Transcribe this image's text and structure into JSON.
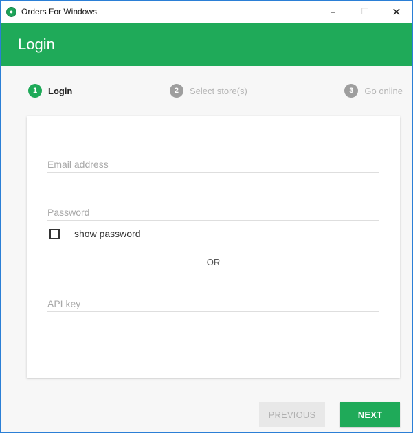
{
  "window": {
    "title": "Orders For Windows",
    "controls": {
      "minimize": "–",
      "maximize": "☐",
      "close": "✕"
    }
  },
  "header": {
    "title": "Login"
  },
  "stepper": {
    "steps": [
      {
        "number": "1",
        "label": "Login",
        "state": "active"
      },
      {
        "number": "2",
        "label": "Select store(s)",
        "state": "inactive"
      },
      {
        "number": "3",
        "label": "Go online",
        "state": "inactive"
      }
    ]
  },
  "form": {
    "email": {
      "placeholder": "Email address",
      "value": ""
    },
    "password": {
      "placeholder": "Password",
      "value": ""
    },
    "show_password": {
      "label": "show password",
      "checked": false
    },
    "or_label": "OR",
    "api_key": {
      "placeholder": "API key",
      "value": ""
    }
  },
  "actions": {
    "previous_label": "PREVIOUS",
    "next_label": "NEXT"
  },
  "colors": {
    "accent": "#1faa59",
    "inactive_step": "#9e9e9e",
    "disabled_button": "#e8e8e8"
  },
  "icons": {
    "app": "app-logo-icon",
    "minimize": "minimize-icon",
    "maximize": "maximize-icon",
    "close": "close-icon",
    "checkbox": "checkbox-icon"
  }
}
